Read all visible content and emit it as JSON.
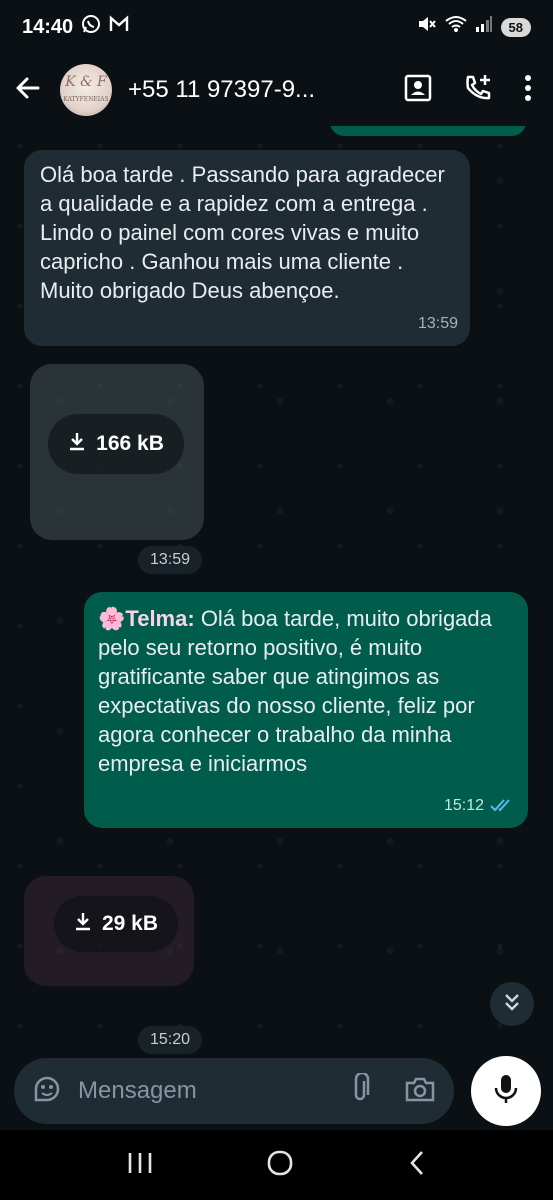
{
  "status_bar": {
    "time": "14:40",
    "battery": "58",
    "left_icons": [
      "whatsapp-icon",
      "gmail-icon"
    ],
    "right_icons": [
      "mute-icon",
      "wifi-icon",
      "signal-icon"
    ]
  },
  "header": {
    "back_icon": "arrow-left-icon",
    "avatar_monogram": "K & F",
    "avatar_brand": "KATYFENEIAS",
    "contact": "+55 11 97397-9...",
    "actions": [
      "contact-card-icon",
      "add-call-icon",
      "more-vertical-icon"
    ]
  },
  "messages": [
    {
      "direction": "in",
      "type": "text",
      "text": "Olá boa tarde . Passando para agradecer a qualidade e a rapidez com a entrega . Lindo o painel com cores vivas e muito capricho . Ganhou mais uma cliente . Muito obrigado Deus abençoe.",
      "time": "13:59"
    },
    {
      "direction": "in",
      "type": "media",
      "size": "166 kB",
      "time": "13:59"
    },
    {
      "direction": "out",
      "type": "text",
      "emoji": "🌸",
      "sender": "Telma:",
      "text": "Olá boa tarde, muito obrigada pelo seu retorno positivo, é muito gratificante saber que atingimos as expectativas do nosso cliente, feliz por agora conhecer o trabalho da minha empresa e iniciarmos",
      "time": "15:12",
      "status": "read"
    },
    {
      "direction": "in",
      "type": "media",
      "size": "29 kB",
      "time": "15:20"
    }
  ],
  "composer": {
    "placeholder": "Mensagem",
    "icons": [
      "sticker-icon",
      "attach-icon",
      "camera-icon",
      "mic-icon"
    ]
  },
  "navbar": [
    "recent-apps-icon",
    "home-icon",
    "back-icon"
  ],
  "colors": {
    "background": "#0b1014",
    "incoming_bubble": "#1f2c34",
    "outgoing_bubble": "#005c4b",
    "read_ticks": "#53bdeb"
  }
}
